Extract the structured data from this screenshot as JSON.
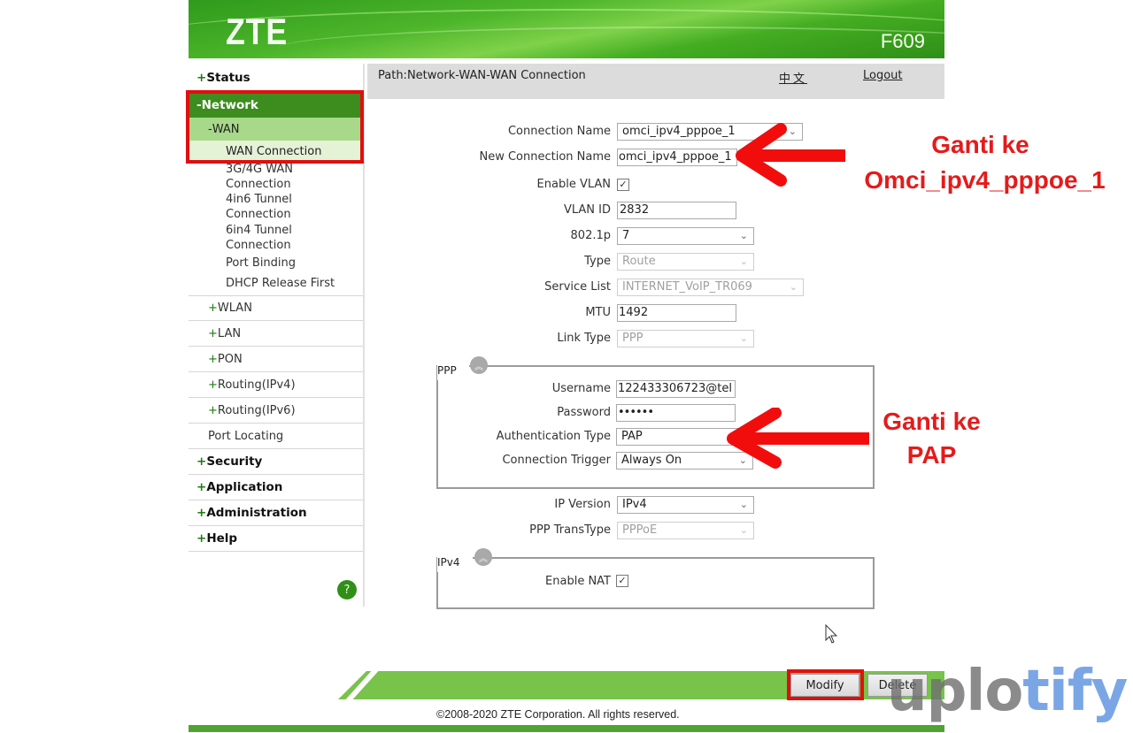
{
  "header": {
    "logo": "ZTE",
    "model": "F609"
  },
  "pathbar": {
    "path": "Path:Network-WAN-WAN Connection",
    "language": "中文",
    "logout": "Logout"
  },
  "sidebar": {
    "top_items": [
      {
        "prefix": "+",
        "label": "Status"
      },
      {
        "prefix": "-",
        "label": "Network"
      },
      {
        "prefix": "+",
        "label": "Security"
      },
      {
        "prefix": "+",
        "label": "Application"
      },
      {
        "prefix": "+",
        "label": "Administration"
      },
      {
        "prefix": "+",
        "label": "Help"
      }
    ],
    "network_sub": [
      {
        "prefix": "-",
        "label": "WAN"
      },
      {
        "prefix": "+",
        "label": "WLAN"
      },
      {
        "prefix": "+",
        "label": "LAN"
      },
      {
        "prefix": "+",
        "label": "PON"
      },
      {
        "prefix": "+",
        "label": "Routing(IPv4)"
      },
      {
        "prefix": "+",
        "label": "Routing(IPv6)"
      },
      {
        "prefix": "",
        "label": "Port Locating"
      }
    ],
    "wan_leaves": [
      {
        "label": "WAN Connection",
        "active": true
      },
      {
        "label": "3G/4G WAN Connection"
      },
      {
        "label": "4in6 Tunnel Connection"
      },
      {
        "label": "6in4 Tunnel Connection"
      },
      {
        "label": "Port Binding"
      },
      {
        "label": "DHCP Release First"
      }
    ],
    "help_icon": "?"
  },
  "form": {
    "connection_name": {
      "label": "Connection Name",
      "value": "omci_ipv4_pppoe_1"
    },
    "new_connection_name": {
      "label": "New Connection Name",
      "value": "omci_ipv4_pppoe_1"
    },
    "enable_vlan": {
      "label": "Enable VLAN",
      "checked": true
    },
    "vlan_id": {
      "label": "VLAN ID",
      "value": "2832"
    },
    "dot1p": {
      "label": "802.1p",
      "value": "7"
    },
    "type": {
      "label": "Type",
      "value": "Route",
      "disabled": true
    },
    "service_list": {
      "label": "Service List",
      "value": "INTERNET_VoIP_TR069",
      "disabled": true
    },
    "mtu": {
      "label": "MTU",
      "value": "1492"
    },
    "link_type": {
      "label": "Link Type",
      "value": "PPP",
      "disabled": true
    },
    "ppp": {
      "legend": "PPP",
      "username": {
        "label": "Username",
        "value": "122433306723@tel"
      },
      "password": {
        "label": "Password",
        "value": "••••••"
      },
      "auth_type": {
        "label": "Authentication Type",
        "value": "PAP"
      },
      "connection_trigger": {
        "label": "Connection Trigger",
        "value": "Always On"
      }
    },
    "ip_version": {
      "label": "IP Version",
      "value": "IPv4"
    },
    "ppp_transtype": {
      "label": "PPP TransType",
      "value": "PPPoE",
      "disabled": true
    },
    "ipv4": {
      "legend": "IPv4",
      "enable_nat": {
        "label": "Enable NAT",
        "checked": true
      }
    }
  },
  "buttons": {
    "modify": "Modify",
    "delete": "Delete"
  },
  "footer": {
    "copyright": "©2008-2020 ZTE Corporation. All rights reserved."
  },
  "annotations": {
    "name_note_line1": "Ganti ke",
    "name_note_line2": "Omci_ipv4_pppoe_1",
    "auth_note_line1": "Ganti ke",
    "auth_note_line2": "PAP",
    "accent_color": "#e41b1b"
  },
  "watermark": {
    "part1": "uplo",
    "part2": "tify"
  },
  "icons": {
    "checkmark": "✓",
    "chevron": "⌄",
    "collapse": "︽"
  }
}
